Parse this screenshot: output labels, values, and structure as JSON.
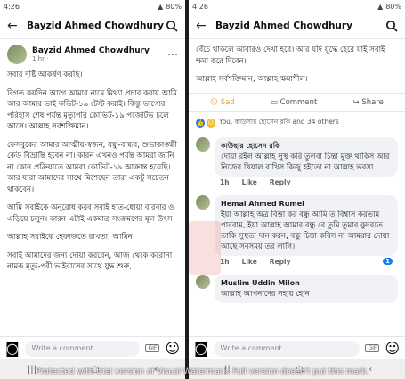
{
  "status": {
    "time": "4:26",
    "battery": "80%"
  },
  "appbar": {
    "title": "Bayzid Ahmed Chowdhury"
  },
  "post": {
    "author": "Bayzid Ahmed Chowdhury",
    "time": "1 hr ·",
    "paragraphs": [
      "সবার দৃষ্টি আকর্ষণ করছি।",
      "বিগত কয়দিন আগে আমার নামে মিথ্যা প্রচার করায় আমি আর আমার ভাই কভিট-১৯ টেস্ট করাই। কিন্তু ভাগ্যের পরিহাস শেষ পর্যন্ত মৃত্যুপরি কোভিট-১৯ পজেটিভ চলে আসে। আল্লাহ সর্বশক্তিমান।",
      "ফেসবুকের আমার আত্মীয়-স্বজন, বন্ধু-বান্ধব, শুভাকাঙ্ক্ষী কেউ বিভ্রান্তি হবেন না। কারন এখনও পর্যন্ত আমরা জানি না কোন প্রক্রিয়াতে আমরা কোভিট-১৯ আক্রান্ত হয়েছি। আর যারা আমাদের সাথে মিশেছেন তারা একটু সচেতন থাকবেন।",
      "আমি সবাইকে অনুরোধ করব সবাই হাত-ধোয়া বারবার ও এড়িয়ে চলুন। কারন এটাই একমাত্র সংক্রমণের মূল উৎস।",
      "আল্লাহ সবাইকে হেফাজতে রাখতা, আমিন",
      "সবাই আমাদের জন্য দোয়া করবেন, আজ থেকে করোনা নামক মৃত্যু-পরী ভাইরাসের সাথে যুদ্ধ শুরু,"
    ],
    "right_tail": [
      "বেঁচে থাকলে আবারও দেখা হবে। আর যদি যুদ্ধে হেরে যাই সবাই ক্ষমা করে দিবেন।",
      "আল্লাহ সর্বশক্তিমান, আল্লাহ ক্ষমাশীল।"
    ],
    "actions": {
      "sad": "Sad",
      "comment": "Comment",
      "share": "Share"
    },
    "likes_text": "You, কাউসার হোসেন রকি and 34 others"
  },
  "comments": [
    {
      "name": "কাউছার হোসেন রকি",
      "text": "দোয়া রইল আল্লাহ সুস্থ করি তুলবা চিন্তা মুক্ত থাকিস আর নিজের খিয়াল রাখিস কিজু হইতো না আল্লাহ ভরসা",
      "time": "1h",
      "like": "Like",
      "reply": "Reply",
      "count": ""
    },
    {
      "name": "Hemal Ahmed Rumel",
      "text": "ইয়া আল্লাহ অত্র বিত্তা কর বন্ধু আমি ত বিশ্বাস করতাম পারবাম, ইয়া আল্লাহ আমার বন্ধু রে তুমি তুমার কুদরতে তাকি সুস্থতা দান করন, বন্ধু চিন্তা করিস না আমরার দোয়া আছে সবসময় তর লাগি।",
      "time": "1h",
      "like": "Like",
      "reply": "Reply",
      "count": "1"
    },
    {
      "name": "Muslim Uddin Milon",
      "text": "আল্লাহ আপনাদের সহায় হোন",
      "time": "",
      "like": "",
      "reply": "",
      "count": ""
    }
  ],
  "composer": {
    "placeholder": "Write a comment...",
    "gif": "GIF"
  },
  "watermark": "Protected with trial version of Visual Watermark. Full version doesn't put this mark."
}
